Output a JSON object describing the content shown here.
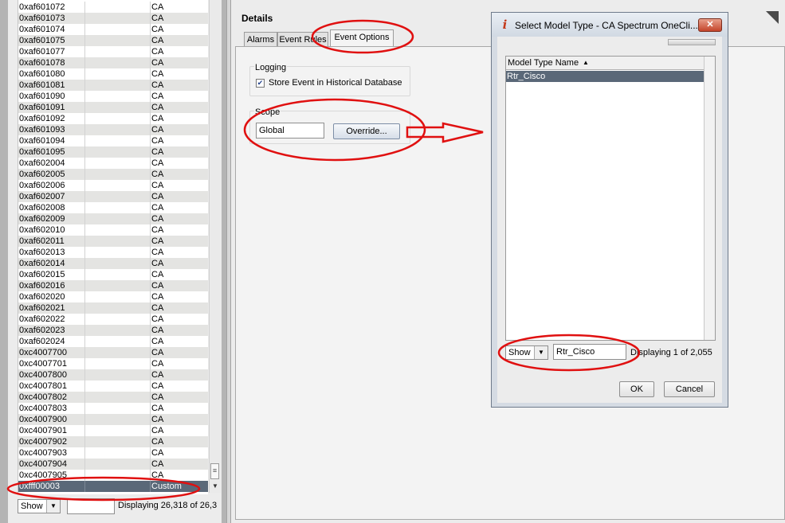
{
  "left_list": {
    "rows": [
      {
        "code": "0xaf601072",
        "type": "CA"
      },
      {
        "code": "0xaf601073",
        "type": "CA"
      },
      {
        "code": "0xaf601074",
        "type": "CA"
      },
      {
        "code": "0xaf601075",
        "type": "CA"
      },
      {
        "code": "0xaf601077",
        "type": "CA"
      },
      {
        "code": "0xaf601078",
        "type": "CA"
      },
      {
        "code": "0xaf601080",
        "type": "CA"
      },
      {
        "code": "0xaf601081",
        "type": "CA"
      },
      {
        "code": "0xaf601090",
        "type": "CA"
      },
      {
        "code": "0xaf601091",
        "type": "CA"
      },
      {
        "code": "0xaf601092",
        "type": "CA"
      },
      {
        "code": "0xaf601093",
        "type": "CA"
      },
      {
        "code": "0xaf601094",
        "type": "CA"
      },
      {
        "code": "0xaf601095",
        "type": "CA"
      },
      {
        "code": "0xaf602004",
        "type": "CA"
      },
      {
        "code": "0xaf602005",
        "type": "CA"
      },
      {
        "code": "0xaf602006",
        "type": "CA"
      },
      {
        "code": "0xaf602007",
        "type": "CA"
      },
      {
        "code": "0xaf602008",
        "type": "CA"
      },
      {
        "code": "0xaf602009",
        "type": "CA"
      },
      {
        "code": "0xaf602010",
        "type": "CA"
      },
      {
        "code": "0xaf602011",
        "type": "CA"
      },
      {
        "code": "0xaf602013",
        "type": "CA"
      },
      {
        "code": "0xaf602014",
        "type": "CA"
      },
      {
        "code": "0xaf602015",
        "type": "CA"
      },
      {
        "code": "0xaf602016",
        "type": "CA"
      },
      {
        "code": "0xaf602020",
        "type": "CA"
      },
      {
        "code": "0xaf602021",
        "type": "CA"
      },
      {
        "code": "0xaf602022",
        "type": "CA"
      },
      {
        "code": "0xaf602023",
        "type": "CA"
      },
      {
        "code": "0xaf602024",
        "type": "CA"
      },
      {
        "code": "0xc4007700",
        "type": "CA"
      },
      {
        "code": "0xc4007701",
        "type": "CA"
      },
      {
        "code": "0xc4007800",
        "type": "CA"
      },
      {
        "code": "0xc4007801",
        "type": "CA"
      },
      {
        "code": "0xc4007802",
        "type": "CA"
      },
      {
        "code": "0xc4007803",
        "type": "CA"
      },
      {
        "code": "0xc4007900",
        "type": "CA"
      },
      {
        "code": "0xc4007901",
        "type": "CA"
      },
      {
        "code": "0xc4007902",
        "type": "CA"
      },
      {
        "code": "0xc4007903",
        "type": "CA"
      },
      {
        "code": "0xc4007904",
        "type": "CA"
      },
      {
        "code": "0xc4007905",
        "type": "CA"
      }
    ],
    "selected_row": {
      "code": "0xfff00003",
      "type": "Custom"
    },
    "footer": {
      "show_label": "Show",
      "filter_value": "",
      "count_text": "Displaying 26,318 of 26,3"
    }
  },
  "details": {
    "title": "Details",
    "tabs": [
      "Alarms",
      "Event Rules",
      "Event Options"
    ],
    "active_tab": "Event Options",
    "logging": {
      "group_title": "Logging",
      "checkbox_label": "Store Event in Historical Database",
      "checked": true
    },
    "scope": {
      "group_title": "Scope",
      "value": "Global",
      "override_label": "Override..."
    }
  },
  "dialog": {
    "title": "Select Model Type - CA Spectrum OneCli...",
    "close_glyph": "✕",
    "info_glyph": "i",
    "table": {
      "column_header": "Model Type Name",
      "sort_glyph": "▲",
      "rows": [
        "Rtr_Cisco"
      ]
    },
    "footer": {
      "show_label": "Show",
      "filter_value": "Rtr_Cisco",
      "count_text": "Displaying 1 of 2,055"
    },
    "ok_label": "OK",
    "cancel_label": "Cancel"
  },
  "colors": {
    "selection": "#5a6878",
    "annotation_red": "#e01010",
    "close_button": "#c4442a"
  },
  "icons": {
    "list_scroll_thumb": "grip-icon",
    "list_scroll_down": "arrow-down-icon",
    "combo_arrow": "chevron-down-icon",
    "dialog_info": "info-icon",
    "dialog_close": "close-icon",
    "corner": "corner-triangle-icon"
  }
}
